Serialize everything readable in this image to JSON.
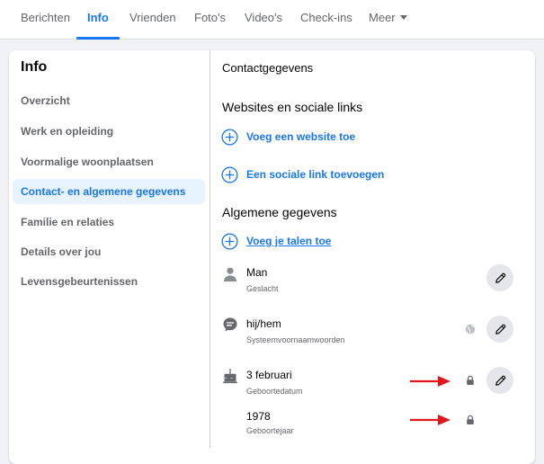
{
  "nav": {
    "tabs": [
      {
        "label": "Berichten"
      },
      {
        "label": "Info"
      },
      {
        "label": "Vrienden"
      },
      {
        "label": "Foto's"
      },
      {
        "label": "Video's"
      },
      {
        "label": "Check-ins"
      },
      {
        "label": "Meer"
      }
    ],
    "active_tab": "Info"
  },
  "sidebar": {
    "title": "Info",
    "items": [
      {
        "label": "Overzicht"
      },
      {
        "label": "Werk en opleiding"
      },
      {
        "label": "Voormalige woonplaatsen"
      },
      {
        "label": "Contact- en algemene gegevens"
      },
      {
        "label": "Familie en relaties"
      },
      {
        "label": "Details over jou"
      },
      {
        "label": "Levensgebeurtenissen"
      }
    ],
    "active_item": "Contact- en algemene gegevens"
  },
  "main": {
    "header": "Contactgegevens",
    "websites_section": {
      "title": "Websites en sociale links",
      "add_website": "Voeg een website toe",
      "add_social": "Een sociale link toevoegen"
    },
    "general_section": {
      "title": "Algemene gegevens",
      "add_languages": "Voeg je talen toe",
      "rows": [
        {
          "value": "Man",
          "label": "Geslacht",
          "icon": "person-icon",
          "privacy": null
        },
        {
          "value": "hij/hem",
          "label": "Systeemvoornaamwoorden",
          "icon": "speech-bubble-icon",
          "privacy": "globe-icon"
        },
        {
          "value": "3 februari",
          "label": "Geboortedatum",
          "icon": "cake-icon",
          "privacy": "lock-icon"
        },
        {
          "value": "1978",
          "label": "Geboortejaar",
          "icon": null,
          "privacy": "lock-icon"
        }
      ]
    }
  },
  "colors": {
    "accent": "#1877f2",
    "annotation_arrow": "#e0181b",
    "muted_text": "#65676b",
    "background": "#f0f2f5"
  }
}
